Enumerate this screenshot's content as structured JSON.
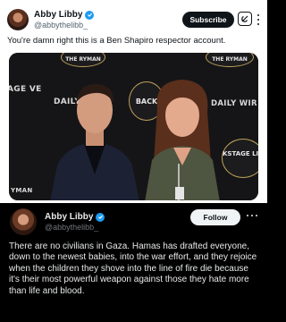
{
  "top_post": {
    "name": "Abby Libby",
    "handle": "@abbythelibb_",
    "subscribe_label": "Subscribe",
    "text": "You're damn right this is a Ben Shapiro respector account.",
    "icons": [
      "verified-badge-icon",
      "grok-icon",
      "more-options-icon"
    ],
    "photo": {
      "backdrop_texts": [
        "THE RYMAN",
        "DAILY WI",
        "BACK",
        "DAILY WIR",
        "THE RYMAN",
        "AGE VE",
        "KSTAGE LIVE",
        "YMAN"
      ],
      "backdrop_badge_texts": [
        "BACKSTAGE",
        "LIVE"
      ]
    }
  },
  "bottom_post": {
    "name": "Abby Libby",
    "handle": "@abbythelibb_",
    "follow_label": "Follow",
    "text": "There are no civilians in Gaza. Hamas has drafted everyone, down to the newest babies, into the war effort, and they rejoice when the children they shove into the line of fire die because it's their most powerful weapon against those they hate more than life and blood.",
    "icons": [
      "verified-badge-icon",
      "more-options-icon"
    ]
  },
  "colors": {
    "verified_blue": "#1d9bf0",
    "dark_bg": "#000000",
    "light_bg": "#ffffff",
    "text_light": "#e7e9ea",
    "text_dark": "#0f1419",
    "secondary_text": "#536471",
    "backdrop_gold": "#bfa15a"
  }
}
